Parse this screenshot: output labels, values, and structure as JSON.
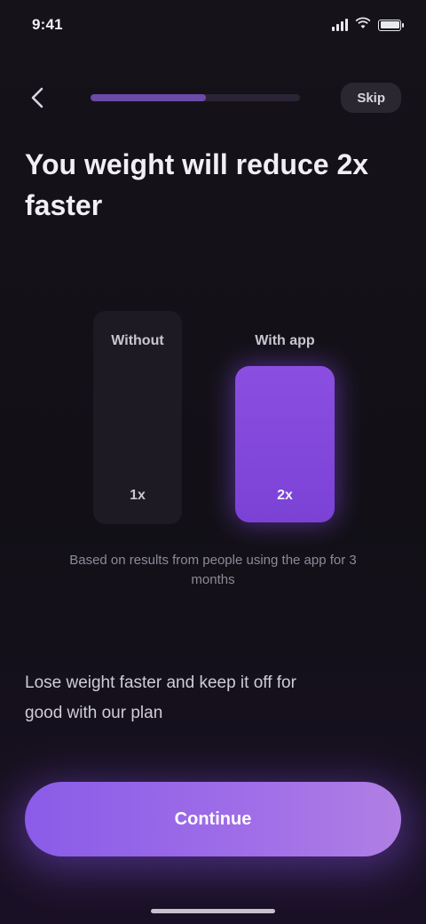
{
  "status_bar": {
    "time": "9:41",
    "signal_icon": "signal-icon",
    "battery_icon": "battery-icon"
  },
  "header": {
    "back_icon": "chevron-left-icon",
    "progress": 0.55,
    "skip_label": "Skip"
  },
  "headline": "You weight will reduce 2x faster",
  "chart": {
    "without_label": "Without",
    "with_label": "With app",
    "without_value": "1x",
    "with_value": "2x",
    "note": "Based on results from people using the app for 3 months"
  },
  "description": "Lose weight faster and keep it off for good with our plan",
  "cta": {
    "label": "Continue"
  },
  "colors": {
    "accent": "#8a5ce8",
    "background": "#121016"
  }
}
